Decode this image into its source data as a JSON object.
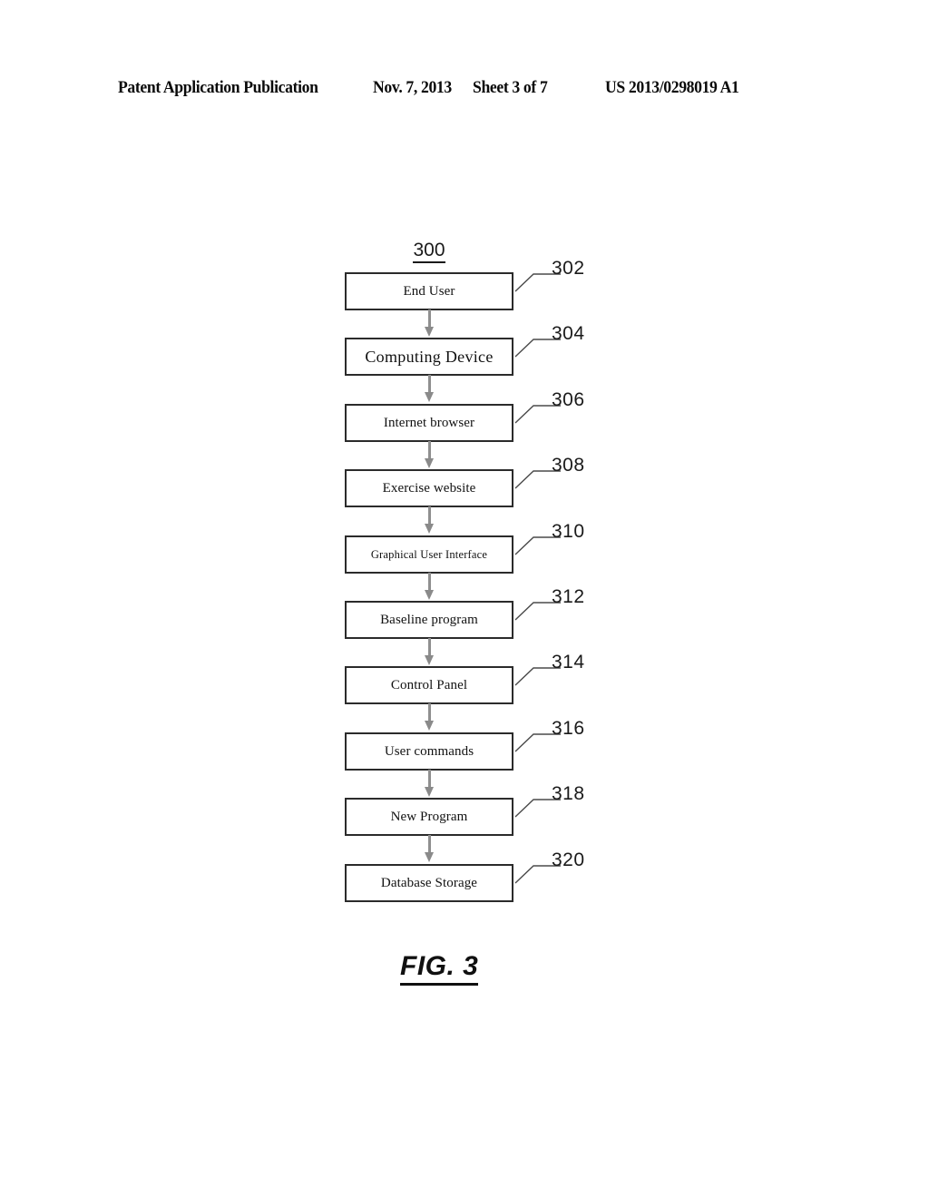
{
  "header": {
    "publication": "Patent Application Publication",
    "date": "Nov. 7, 2013",
    "sheet": "Sheet 3 of 7",
    "publication_number": "US 2013/0298019 A1"
  },
  "figure": {
    "figure_ref": "300",
    "caption": "FIG. 3",
    "colors": {
      "box_border": "#2b2b2b",
      "arrow": "#8a8a8a",
      "text": "#111111",
      "background": "#ffffff"
    },
    "nodes": [
      {
        "label": "End User",
        "ref": "302",
        "size": "md"
      },
      {
        "label": "Computing Device",
        "ref": "304",
        "size": "lg"
      },
      {
        "label": "Internet browser",
        "ref": "306",
        "size": "md"
      },
      {
        "label": "Exercise website",
        "ref": "308",
        "size": "md"
      },
      {
        "label": "Graphical User Interface",
        "ref": "310",
        "size": "sm"
      },
      {
        "label": "Baseline program",
        "ref": "312",
        "size": "md"
      },
      {
        "label": "Control Panel",
        "ref": "314",
        "size": "md"
      },
      {
        "label": "User commands",
        "ref": "316",
        "size": "md"
      },
      {
        "label": "New Program",
        "ref": "318",
        "size": "md"
      },
      {
        "label": "Database Storage",
        "ref": "320",
        "size": "md"
      }
    ]
  }
}
